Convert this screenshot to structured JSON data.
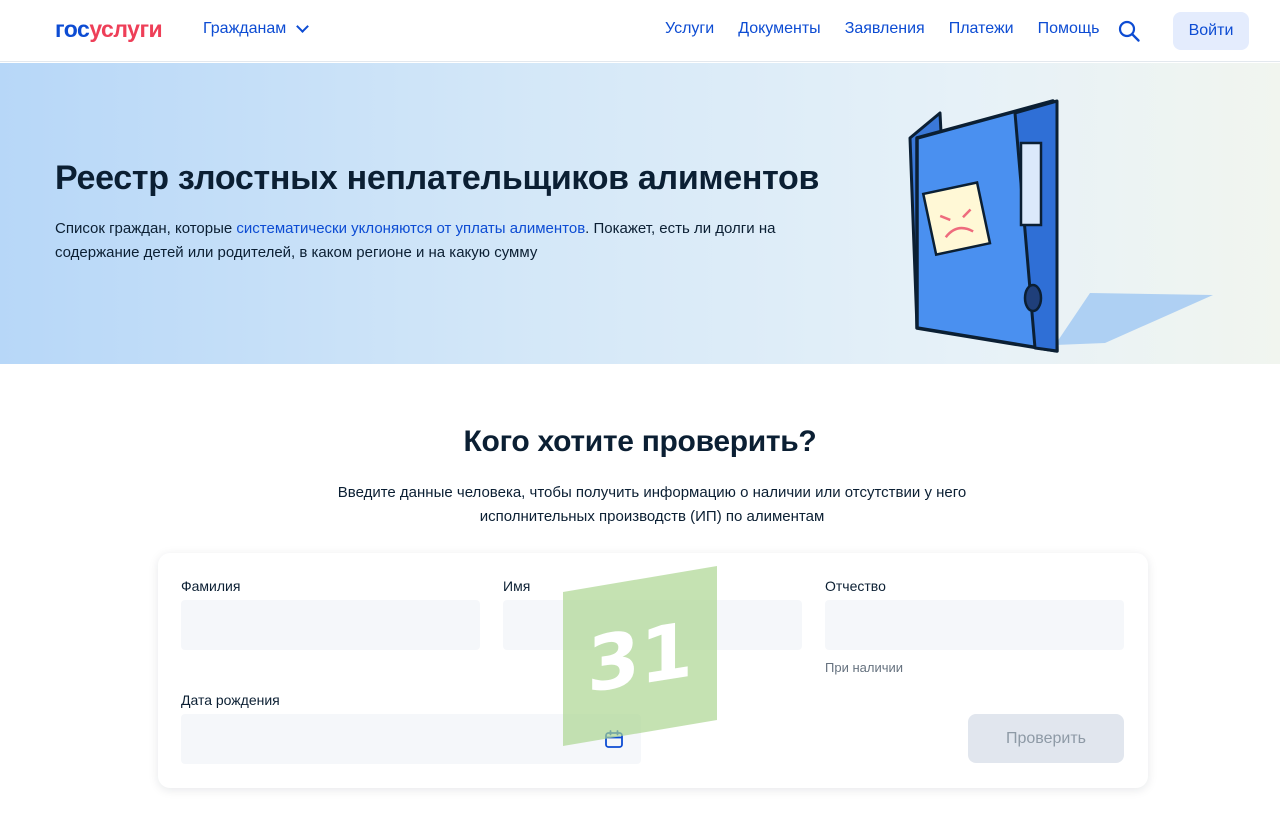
{
  "header": {
    "logo_part1": "гос",
    "logo_part2": "услуги",
    "audience": "Гражданам",
    "nav": [
      "Услуги",
      "Документы",
      "Заявления",
      "Платежи",
      "Помощь"
    ],
    "login_label": "Войти"
  },
  "hero": {
    "title": "Реестр злостных неплательщиков алиментов",
    "desc_before": "Список граждан, которые ",
    "desc_link": "систематически уклоняются от уплаты алиментов",
    "desc_after": ". Покажет, есть ли долги на содержание детей или родителей, в каком регионе и на какую сумму"
  },
  "section": {
    "title": "Кого хотите проверить?",
    "desc": "Введите данные человека, чтобы получить информацию о наличии или отсутствии у него исполнительных производств (ИП) по алиментам"
  },
  "form": {
    "surname_label": "Фамилия",
    "surname_value": "",
    "name_label": "Имя",
    "name_value": "",
    "patronymic_label": "Отчество",
    "patronymic_value": "",
    "patronymic_hint": "При наличии",
    "birthdate_label": "Дата рождения",
    "birthdate_value": "",
    "submit_label": "Проверить"
  },
  "watermark_text": "31",
  "colors": {
    "brand_blue": "#0d4cd3",
    "brand_red": "#ee3f58",
    "text": "#0b1f33",
    "field_bg": "#f5f7fa",
    "button_disabled_bg": "#e1e6ee"
  },
  "icons": {
    "search": "search-icon",
    "chevron": "chevron-down-icon",
    "calendar": "calendar-icon",
    "binder": "binder-illustration"
  }
}
